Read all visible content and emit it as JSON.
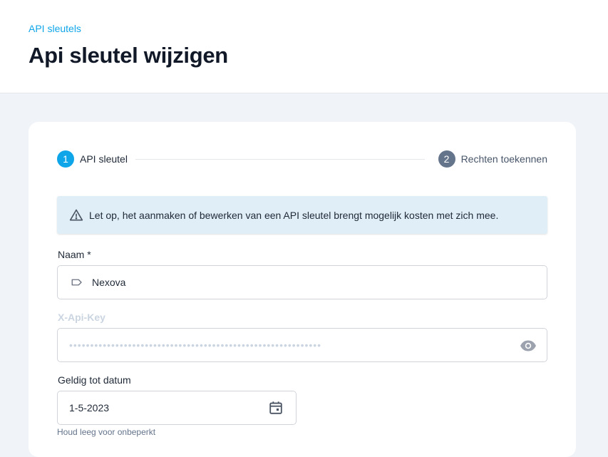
{
  "header": {
    "breadcrumb": "API sleutels",
    "title": "Api sleutel wijzigen"
  },
  "stepper": {
    "steps": [
      {
        "number": "1",
        "label": "API sleutel",
        "active": true
      },
      {
        "number": "2",
        "label": "Rechten toekennen",
        "active": false
      }
    ]
  },
  "alert": {
    "icon": "warning-triangle-icon",
    "text": "Let op, het aanmaken of bewerken van een API sleutel brengt mogelijk kosten met zich mee."
  },
  "form": {
    "name": {
      "label": "Naam *",
      "value": "Nexova",
      "icon": "tag-icon"
    },
    "api_key": {
      "label": "X-Api-Key",
      "value": "••••••••••••••••••••••••••••••••••••••••••••••••••••••••••••",
      "icon": "eye-icon"
    },
    "valid_until": {
      "label": "Geldig tot datum",
      "value": "1-5-2023",
      "icon": "calendar-icon",
      "hint": "Houd leeg voor onbeperkt"
    }
  },
  "colors": {
    "accent": "#0ea5e9",
    "step_inactive": "#64748b",
    "alert_bg": "#e0eef7",
    "page_bg": "#f0f4f8"
  }
}
